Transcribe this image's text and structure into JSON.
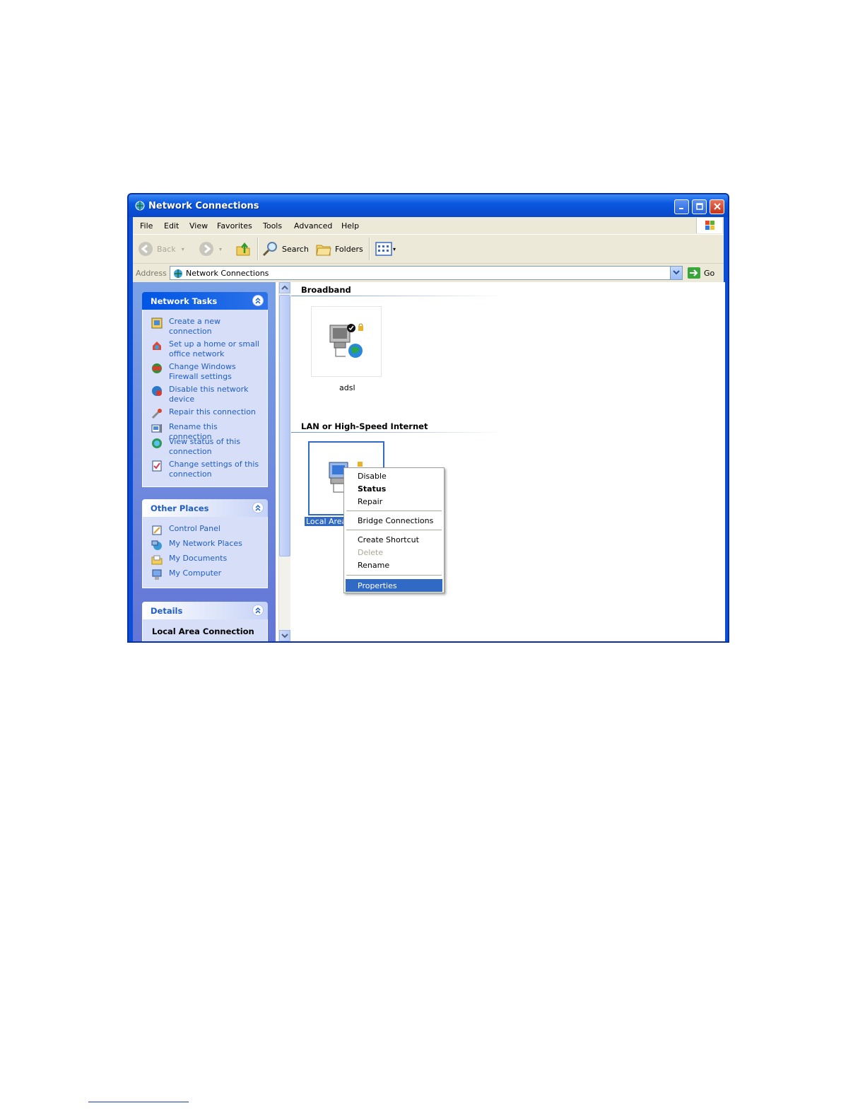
{
  "window": {
    "title": "Network Connections"
  },
  "menu": {
    "items": [
      "File",
      "Edit",
      "View",
      "Favorites",
      "Tools",
      "Advanced",
      "Help"
    ]
  },
  "toolbar": {
    "back": "Back",
    "search": "Search",
    "folders": "Folders"
  },
  "address": {
    "label": "Address",
    "value": "Network Connections",
    "go": "Go"
  },
  "sidebar": {
    "network_tasks": {
      "title": "Network Tasks",
      "items": [
        {
          "label": "Create a new connection",
          "icon": "new-connection-icon"
        },
        {
          "label": "Set up a home or small office network",
          "icon": "home-network-icon"
        },
        {
          "label": "Change Windows Firewall settings",
          "icon": "firewall-icon"
        },
        {
          "label": "Disable this network device",
          "icon": "disable-device-icon"
        },
        {
          "label": "Repair this connection",
          "icon": "repair-icon"
        },
        {
          "label": "Rename this connection",
          "icon": "rename-icon"
        },
        {
          "label": "View status of this connection",
          "icon": "status-icon"
        },
        {
          "label": "Change settings of this connection",
          "icon": "settings-icon"
        }
      ]
    },
    "other_places": {
      "title": "Other Places",
      "items": [
        {
          "label": "Control Panel",
          "icon": "control-panel-icon"
        },
        {
          "label": "My Network Places",
          "icon": "network-places-icon"
        },
        {
          "label": "My Documents",
          "icon": "documents-icon"
        },
        {
          "label": "My Computer",
          "icon": "computer-icon"
        }
      ]
    },
    "details": {
      "title": "Details",
      "subtitle": "Local Area Connection"
    }
  },
  "main": {
    "groups": [
      {
        "title": "Broadband",
        "items": [
          {
            "label": "adsl",
            "icon": "broadband-connection-icon"
          }
        ]
      },
      {
        "title": "LAN or High-Speed Internet",
        "items": [
          {
            "label": "Local Area",
            "icon": "lan-connection-icon",
            "selected": true
          }
        ]
      }
    ]
  },
  "context_menu": {
    "items": [
      {
        "label": "Disable"
      },
      {
        "label": "Status",
        "style": "bold"
      },
      {
        "label": "Repair"
      },
      {
        "label": "Bridge Connections"
      },
      {
        "label": "Create Shortcut"
      },
      {
        "label": "Delete",
        "style": "disabled"
      },
      {
        "label": "Rename"
      },
      {
        "label": "Properties",
        "style": "highlighted"
      }
    ]
  },
  "colors": {
    "titlebar": "#0a58e0",
    "selection": "#316ac5",
    "link": "#215dc6"
  }
}
